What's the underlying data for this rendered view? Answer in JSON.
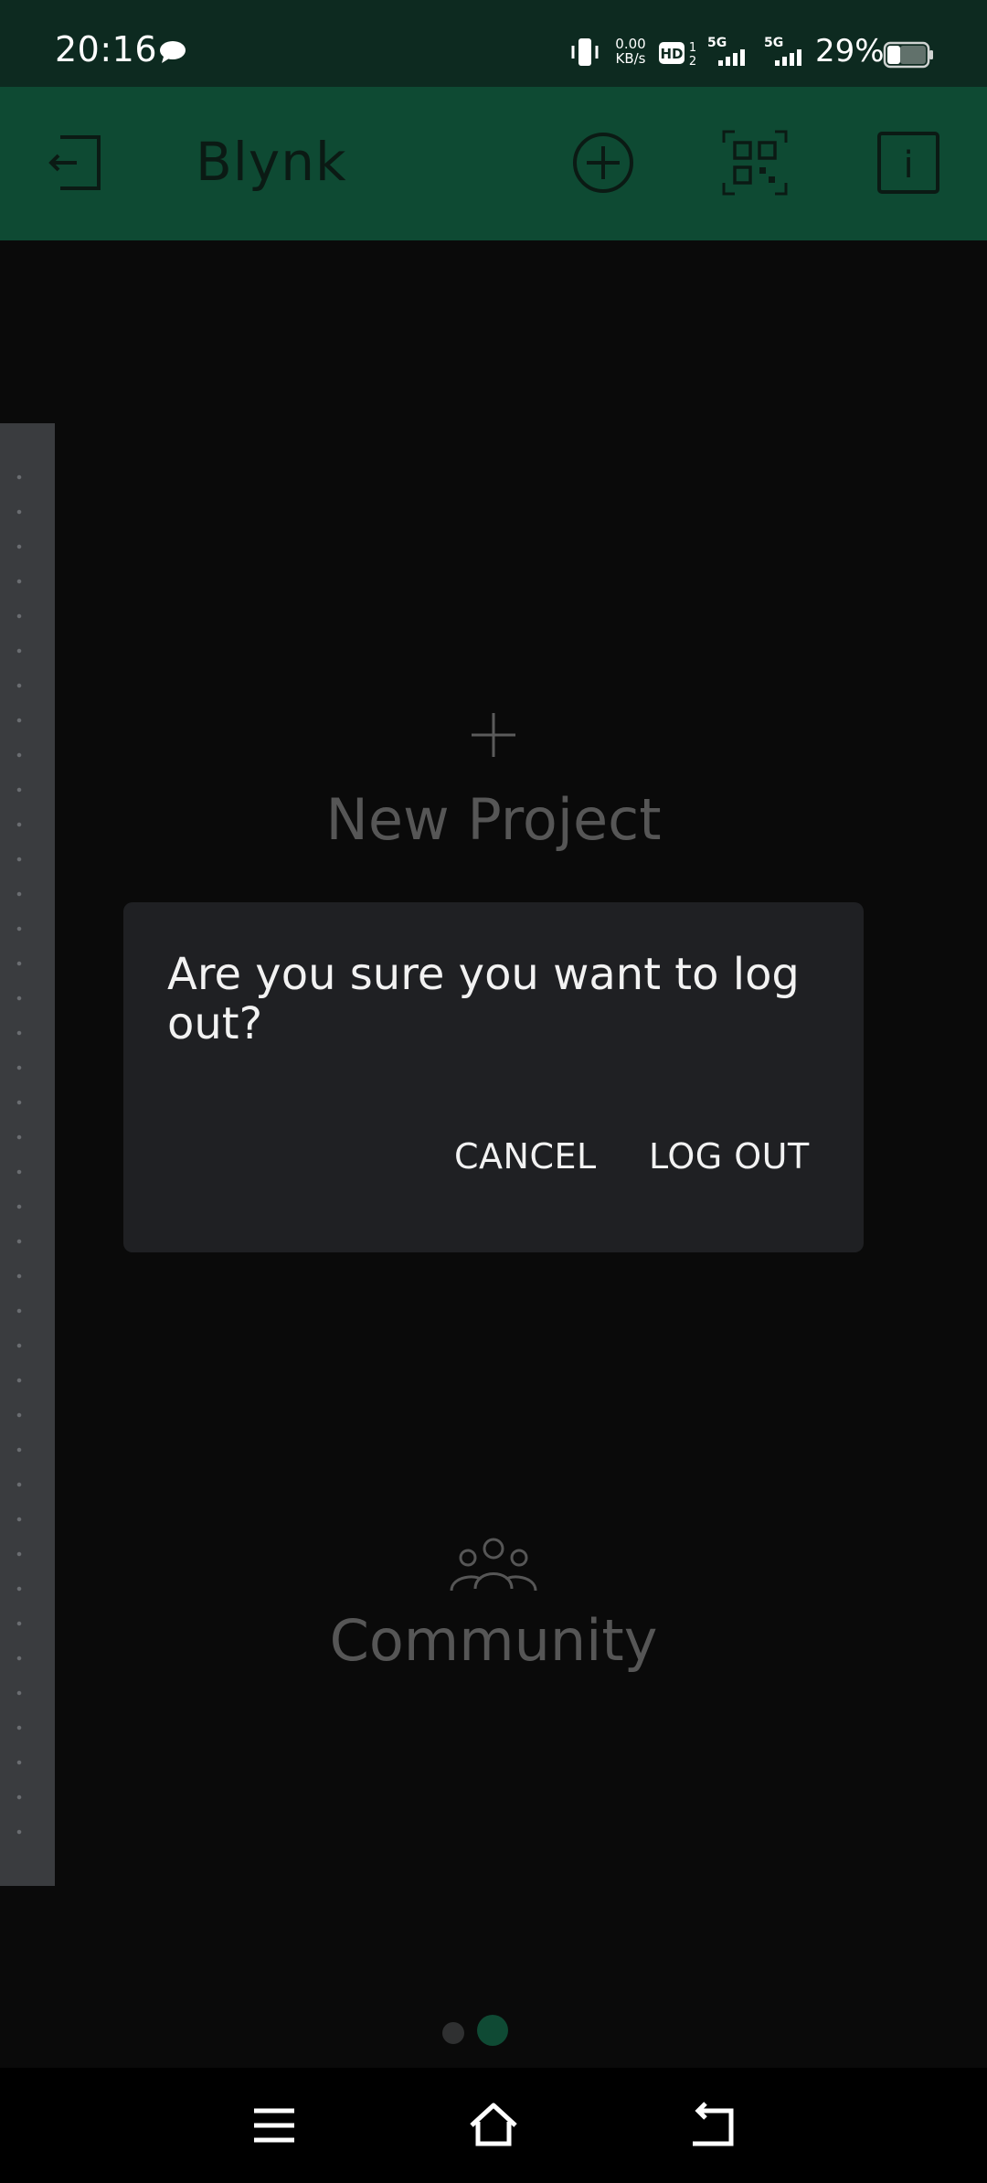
{
  "status_bar": {
    "time": "20:16",
    "net_speed_value": "0.00",
    "net_speed_unit": "KB/s",
    "hd_label": "HD",
    "sim1": "1",
    "sim2": "2",
    "network1": "5G",
    "network2": "5G",
    "battery": "29%",
    "icons": [
      "message-icon",
      "vibrate-icon",
      "hd-icon",
      "signal-icon",
      "signal-icon",
      "battery-icon"
    ]
  },
  "app_bar": {
    "title": "Blynk",
    "icons": [
      "logout-icon",
      "add-icon",
      "qr-code-icon",
      "info-icon"
    ],
    "info_glyph": "i"
  },
  "main": {
    "new_project_label": "New Project",
    "community_label": "Community",
    "pager": {
      "count": 2,
      "active_index": 1
    }
  },
  "dialog": {
    "message": "Are you sure you want to log out?",
    "cancel_label": "CANCEL",
    "logout_label": "LOG OUT"
  },
  "nav_bar": {
    "icons": [
      "menu-icon",
      "home-icon",
      "back-icon"
    ]
  },
  "colors": {
    "status_bar_bg": "#0d2a20",
    "app_bar_bg": "#0e4a33",
    "background": "#0a0a0a",
    "dialog_bg": "#1f2023",
    "accent": "#0f4a34"
  }
}
